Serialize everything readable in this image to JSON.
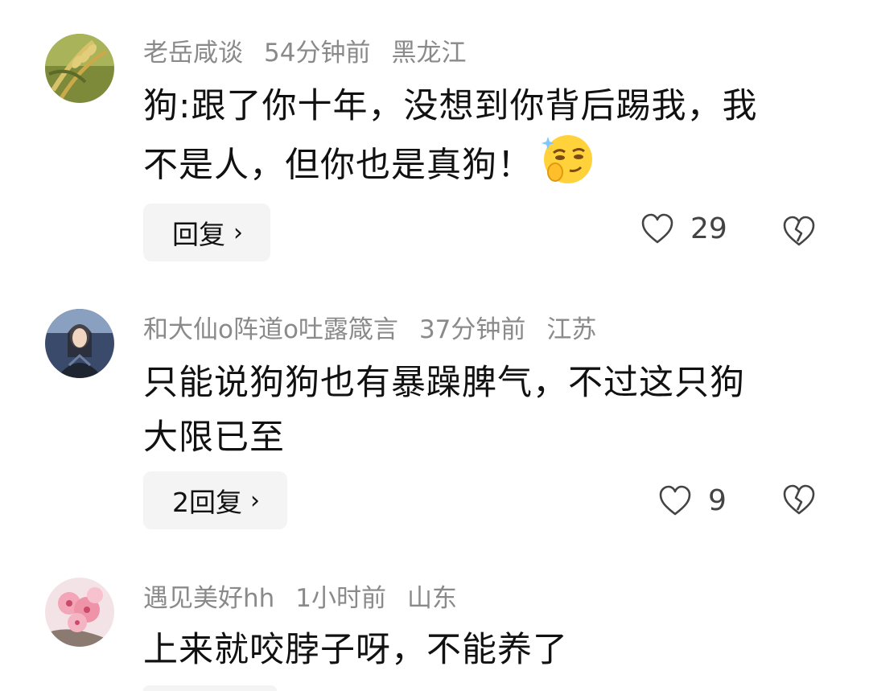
{
  "comments": [
    {
      "username": "老岳咸谈",
      "time": "54分钟前",
      "location": "黑龙江",
      "text_line1": "狗:跟了你十年，没想到你背后踢我，我",
      "text_line2": "不是人，但你也是真狗！",
      "emoji": "smirk-emoji",
      "reply_label": "回复",
      "like_count": "29"
    },
    {
      "username": "和大仙o阵道o吐露箴言",
      "time": "37分钟前",
      "location": "江苏",
      "text_line1": "只能说狗狗也有暴躁脾气，不过这只狗",
      "text_line2": "大限已至",
      "reply_label": "2回复",
      "like_count": "9"
    },
    {
      "username": "遇见美好hh",
      "time": "1小时前",
      "location": "山东",
      "text_line1": "上来就咬脖子呀，不能养了"
    }
  ],
  "colors": {
    "meta": "#8a8a8a",
    "text": "#111111",
    "reply_bg": "#f4f4f4"
  }
}
